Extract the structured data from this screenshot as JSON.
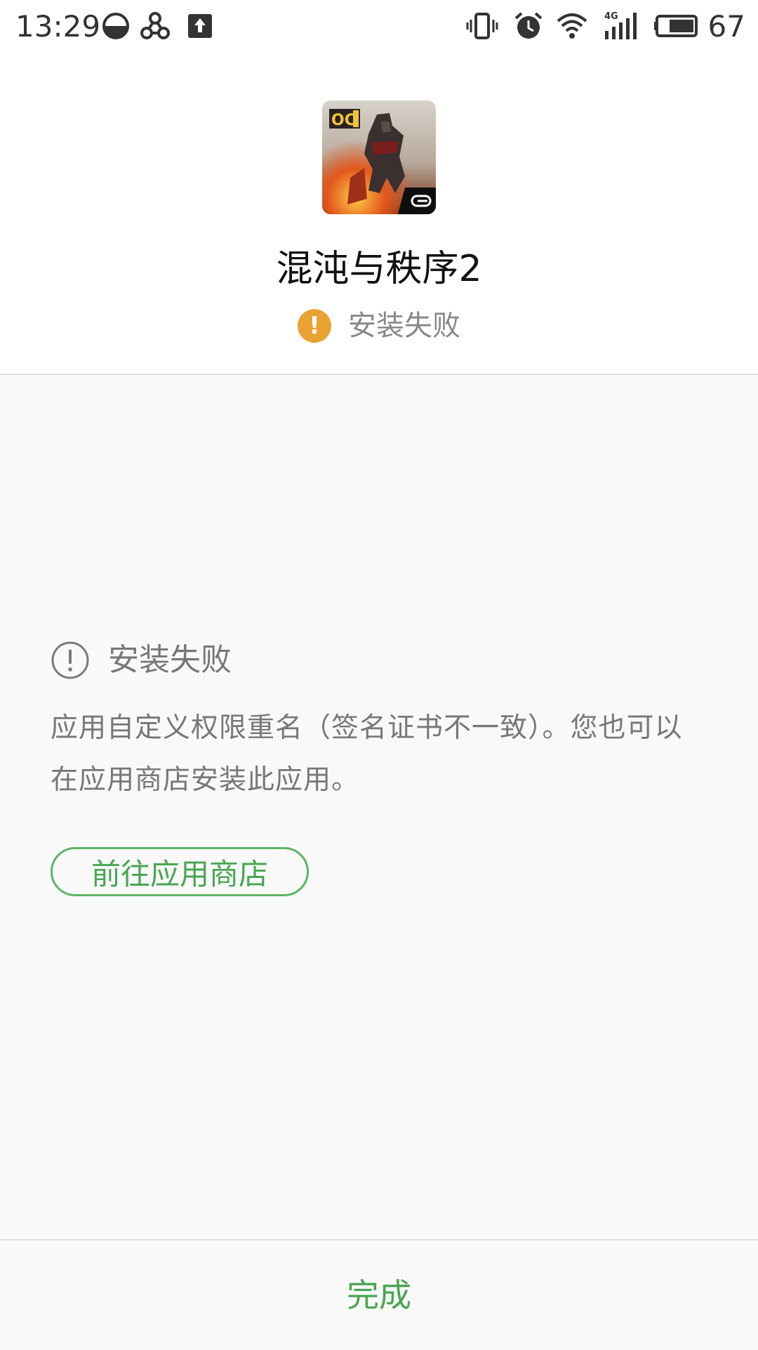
{
  "status_bar": {
    "time": "13:29",
    "left_icons": [
      "half-moon-icon",
      "link-hub-icon",
      "upload-box-icon"
    ],
    "right_icons": [
      "vibrate-icon",
      "alarm-icon",
      "wifi-icon",
      "signal-4g-icon",
      "battery-icon"
    ],
    "network_label": "4G",
    "battery_percent": "67"
  },
  "app": {
    "icon": "game-app-icon",
    "name": "混沌与秩序2",
    "status_label": "安装失败",
    "status_color": "#e9a234"
  },
  "error": {
    "title": "安装失败",
    "message": "应用自定义权限重名（签名证书不一致）。您也可以在应用商店安装此应用。",
    "store_button_label": "前往应用商店"
  },
  "bottom": {
    "done_label": "完成"
  },
  "colors": {
    "accent": "#4aa552",
    "warning": "#e9a234",
    "muted_text": "#777777"
  }
}
